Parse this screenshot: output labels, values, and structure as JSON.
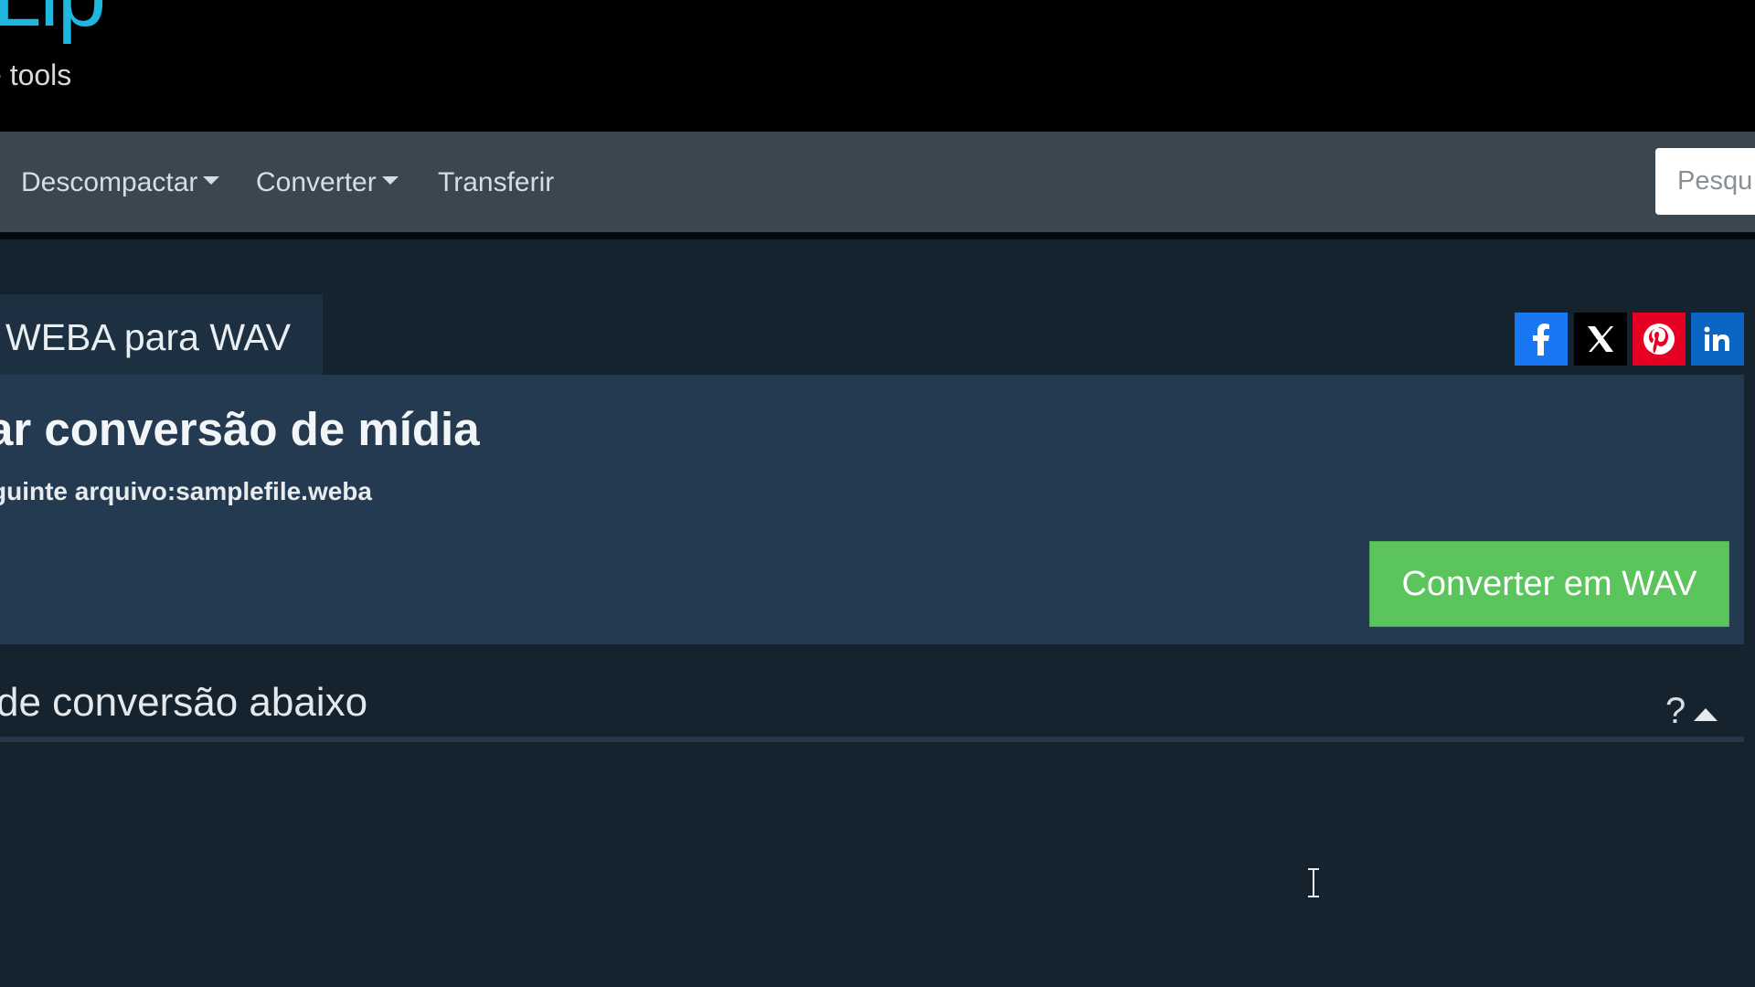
{
  "brand": {
    "logo_text": "Lip",
    "tagline": "e tools"
  },
  "nav": {
    "items": [
      {
        "label": "Descompactar",
        "has_dropdown": true
      },
      {
        "label": "Converter",
        "has_dropdown": true
      },
      {
        "label": "Transferir",
        "has_dropdown": false
      }
    ],
    "search_placeholder": "Pesqu"
  },
  "main": {
    "tab_title": "WEBA para WAV",
    "heading": "ar conversão de mídia",
    "file_line": "guinte arquivo:samplefile.weba",
    "convert_button": "Converter em WAV",
    "options_heading": "de conversão abaixo",
    "help_symbol": "?"
  },
  "social": [
    {
      "icon": "facebook-icon",
      "color": "#1877f2"
    },
    {
      "icon": "x-icon",
      "color": "#000000"
    },
    {
      "icon": "pinterest-icon",
      "color": "#e60023"
    },
    {
      "icon": "linkedin-icon",
      "color": "#0a66c2"
    }
  ],
  "colors": {
    "accent": "#1fb6e0",
    "convert_button": "#5cc45c",
    "navbar": "#3a4650",
    "panel": "#233a51",
    "background": "#15232f"
  }
}
